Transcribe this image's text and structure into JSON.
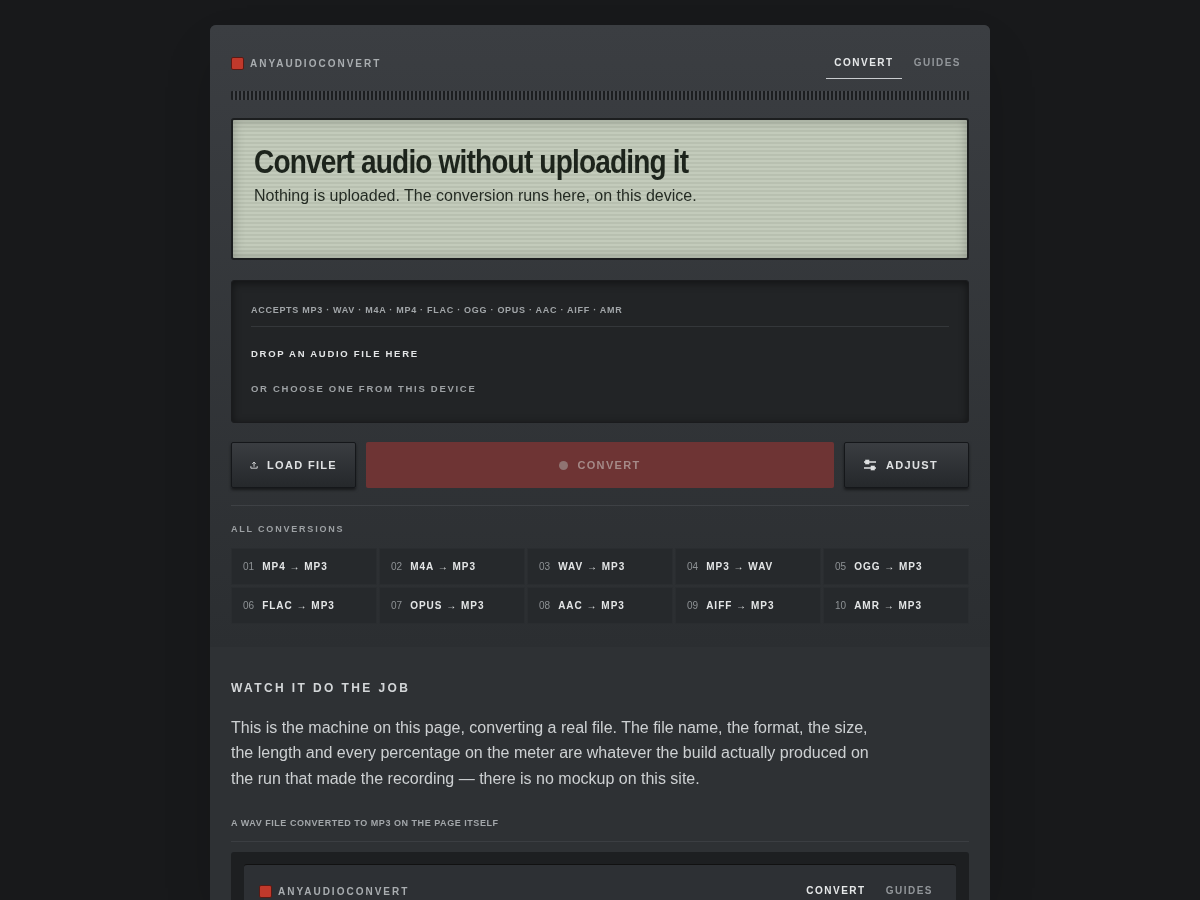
{
  "header": {
    "brand": "ANYAUDIOCONVERT",
    "tabs": [
      {
        "label": "CONVERT",
        "selected": true
      },
      {
        "label": "GUIDES",
        "selected": false
      }
    ]
  },
  "hero": {
    "title": "Convert audio without uploading it",
    "subtitle": "Nothing is uploaded. The conversion runs here, on this device."
  },
  "dropzone": {
    "accepts": "ACCEPTS MP3 · WAV · M4A · MP4 · FLAC · OGG · OPUS · AAC · AIFF · AMR",
    "prompt": "DROP AN AUDIO FILE HERE",
    "secondary": "OR CHOOSE ONE FROM THIS DEVICE"
  },
  "buttons": [
    {
      "label": "LOAD FILE",
      "kind": "upload",
      "disabled": false
    },
    {
      "label": "CONVERT",
      "kind": "primary",
      "disabled": true
    },
    {
      "label": "ADJUST",
      "kind": "adjust",
      "disabled": false
    }
  ],
  "conversions": {
    "title": "ALL CONVERSIONS",
    "items": [
      {
        "number": "01",
        "label": "MP4 → MP3"
      },
      {
        "number": "02",
        "label": "M4A → MP3"
      },
      {
        "number": "03",
        "label": "WAV → MP3"
      },
      {
        "number": "04",
        "label": "MP3 → WAV"
      },
      {
        "number": "05",
        "label": "OGG → MP3"
      },
      {
        "number": "06",
        "label": "FLAC → MP3"
      },
      {
        "number": "07",
        "label": "OPUS → MP3"
      },
      {
        "number": "08",
        "label": "AAC → MP3"
      },
      {
        "number": "09",
        "label": "AIFF → MP3"
      },
      {
        "number": "10",
        "label": "AMR → MP3"
      }
    ]
  },
  "demo": {
    "heading": "WATCH IT DO THE JOB",
    "paragraph": "This is the machine on this page, converting a real file. The file name, the format, the size, the length and every percentage on the meter are whatever the build actually produced on the run that made the recording — there is no mockup on this site.",
    "caption": "A WAV FILE CONVERTED TO MP3 ON THE PAGE ITSELF",
    "preview": {
      "brand": "ANYAUDIOCONVERT",
      "tabs": [
        {
          "label": "CONVERT",
          "selected": true
        },
        {
          "label": "GUIDES",
          "selected": false
        }
      ]
    }
  }
}
